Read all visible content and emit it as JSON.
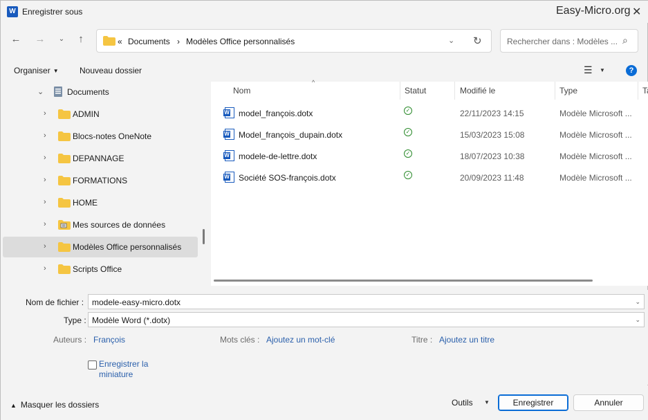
{
  "window": {
    "title": "Enregistrer sous",
    "brand": "Easy-Micro.org",
    "app_icon": "word-icon"
  },
  "nav": {
    "back_icon": "arrow-left-icon",
    "forward_icon": "arrow-right-icon",
    "recent_icon": "chevron-down-icon",
    "up_icon": "arrow-up-icon",
    "breadcrumb": [
      "Documents",
      "Modèles Office personnalisés"
    ],
    "overflow": "«",
    "search_placeholder": "Rechercher dans : Modèles ..."
  },
  "toolbar": {
    "organize": "Organiser",
    "new_folder": "Nouveau dossier",
    "help": "?"
  },
  "tree": {
    "items": [
      {
        "label": "Documents",
        "kind": "library",
        "expanded": true
      },
      {
        "label": "ADMIN",
        "kind": "folder"
      },
      {
        "label": "Blocs-notes OneNote",
        "kind": "folder"
      },
      {
        "label": "DEPANNAGE",
        "kind": "folder"
      },
      {
        "label": "FORMATIONS",
        "kind": "folder"
      },
      {
        "label": "HOME",
        "kind": "folder"
      },
      {
        "label": "Mes sources de données",
        "kind": "datasource"
      },
      {
        "label": "Modèles Office personnalisés",
        "kind": "folder",
        "selected": true
      },
      {
        "label": "Scripts Office",
        "kind": "folder"
      }
    ]
  },
  "files": {
    "columns": {
      "name": "Nom",
      "status": "Statut",
      "modified": "Modifié le",
      "type": "Type",
      "size": "Ta"
    },
    "rows": [
      {
        "name": "model_françois.dotx",
        "modified": "22/11/2023 14:15",
        "type": "Modèle Microsoft ..."
      },
      {
        "name": "Model_françois_dupain.dotx",
        "modified": "15/03/2023 15:08",
        "type": "Modèle Microsoft ..."
      },
      {
        "name": "modele-de-lettre.dotx",
        "modified": "18/07/2023 10:38",
        "type": "Modèle Microsoft ..."
      },
      {
        "name": "Société SOS-françois.dotx",
        "modified": "20/09/2023 11:48",
        "type": "Modèle Microsoft ..."
      }
    ]
  },
  "form": {
    "filename_label": "Nom de fichier :",
    "filename_value": "modele-easy-micro.dotx",
    "type_label": "Type :",
    "type_value": "Modèle Word (*.dotx)",
    "authors_label": "Auteurs :",
    "authors_value": "François",
    "keywords_label": "Mots clés :",
    "keywords_value": "Ajoutez un mot-clé",
    "title_label": "Titre :",
    "title_value": "Ajoutez un titre",
    "thumbnail_line1": "Enregistrer la",
    "thumbnail_line2": "miniature"
  },
  "footer": {
    "hide_folders": "Masquer les dossiers",
    "tools": "Outils",
    "save": "Enregistrer",
    "cancel": "Annuler"
  },
  "colors": {
    "accent": "#0a6cd6",
    "link": "#2a5fab",
    "folder": "#f5c542",
    "status_ok": "#2a8a2a"
  }
}
